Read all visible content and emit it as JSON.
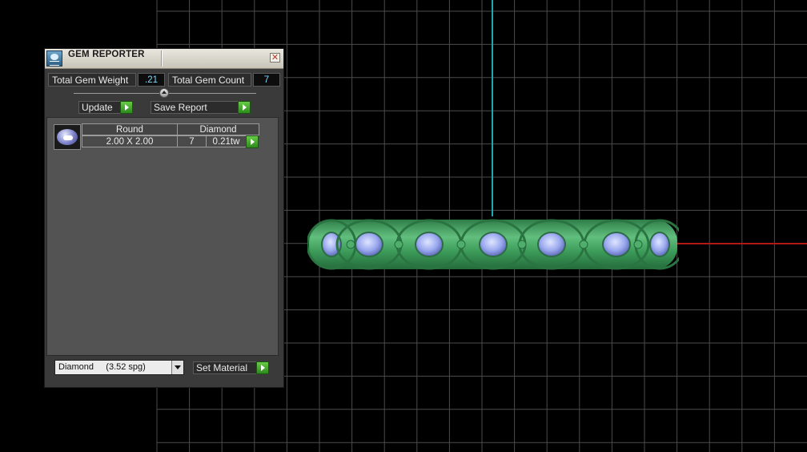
{
  "panel": {
    "title": "GEM REPORTER",
    "close_glyph": "✕",
    "total_weight_label": "Total Gem Weight",
    "total_weight_value": ".21",
    "total_count_label": "Total Gem Count",
    "total_count_value": "7",
    "update_label": "Update",
    "save_report_label": "Save Report",
    "gems": [
      {
        "shape": "Round",
        "material": "Diamond",
        "size": "2.00 X 2.00",
        "count": "7",
        "weight": "0.21tw"
      }
    ],
    "material_select": "Diamond     (3.52 spg)",
    "set_material_label": "Set Material"
  },
  "colors": {
    "grid_line": "#4c4c4c",
    "axis_vertical": "#1fa7b5",
    "axis_horizontal": "#b01818",
    "ring_metal": "#3d9a5c",
    "ring_gem": "#a9b6f2",
    "accent_arrow": "#46b02c"
  },
  "icons": [
    "gem-reporter-app-icon",
    "close-icon",
    "collapse-icon",
    "play-arrow-icon",
    "dropdown-arrow-icon"
  ]
}
